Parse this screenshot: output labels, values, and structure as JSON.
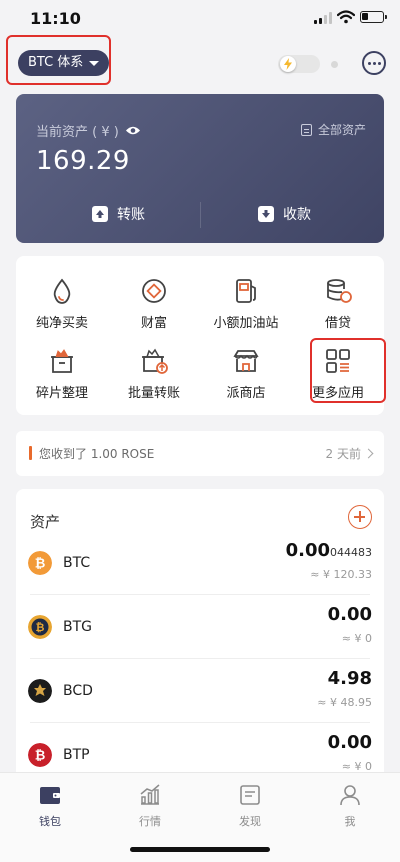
{
  "status": {
    "time": "11:10"
  },
  "header": {
    "system_label": "BTC 体系"
  },
  "asset_card": {
    "label": "当前资产 ( ¥ )",
    "amount": "169.29",
    "all_assets": "全部资产",
    "transfer": "转账",
    "receive": "收款"
  },
  "apps": [
    {
      "label": "纯净买卖",
      "icon": "drop-icon"
    },
    {
      "label": "财富",
      "icon": "wealth-icon"
    },
    {
      "label": "小额加油站",
      "icon": "gas-station-icon"
    },
    {
      "label": "借贷",
      "icon": "loan-icon"
    },
    {
      "label": "碎片整理",
      "icon": "fragment-box-icon"
    },
    {
      "label": "批量转账",
      "icon": "batch-transfer-icon"
    },
    {
      "label": "派商店",
      "icon": "store-icon"
    },
    {
      "label": "更多应用",
      "icon": "more-apps-icon"
    }
  ],
  "notice": {
    "text": "您收到了 1.00 ROSE",
    "time": "2 天前"
  },
  "assets": {
    "title": "资产",
    "rows": [
      {
        "symbol": "BTC",
        "amount_main": "0.00",
        "amount_small": "044483",
        "fiat": "≈ ¥ 120.33",
        "color": "#f29a38"
      },
      {
        "symbol": "BTG",
        "amount_main": "0.00",
        "amount_small": "",
        "fiat": "≈ ¥ 0",
        "color": "#e7a531"
      },
      {
        "symbol": "BCD",
        "amount_main": "4.98",
        "amount_small": "",
        "fiat": "≈ ¥ 48.95",
        "color": "#1c1c1c"
      },
      {
        "symbol": "BTP",
        "amount_main": "0.00",
        "amount_small": "",
        "fiat": "≈ ¥ 0",
        "color": "#c8202a"
      }
    ]
  },
  "nav": [
    {
      "label": "钱包",
      "icon": "wallet-icon",
      "active": true
    },
    {
      "label": "行情",
      "icon": "market-chart-icon",
      "active": false
    },
    {
      "label": "发现",
      "icon": "discover-icon",
      "active": false
    },
    {
      "label": "我",
      "icon": "profile-icon",
      "active": false
    }
  ],
  "colors": {
    "brand": "#3c4061",
    "highlight": "#e0302b",
    "accent": "#e0663a"
  }
}
